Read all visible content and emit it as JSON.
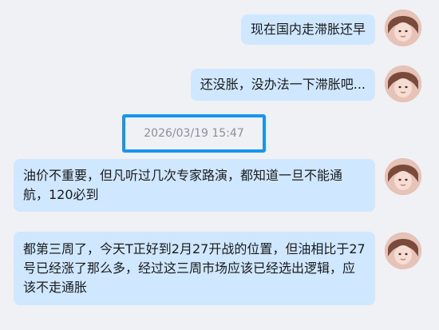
{
  "messages": [
    {
      "text": "现在国内走滞胀还早"
    },
    {
      "text": "还没胀，没办法一下滞胀吧..."
    },
    {
      "text": "油价不重要，但凡听过几次专家路演，都知道一旦不能通航，120必到"
    },
    {
      "text": "都第三周了，今天T正好到2月27开战的位置，但油相比于27号已经涨了那么多，经过这三周市场应该已经选出逻辑，应该不走通胀"
    }
  ],
  "timestamp": "2026/03/19 15:47",
  "colors": {
    "bubble": "#cfe8ff",
    "background": "#f0f1f5",
    "highlight_border": "#1596f0",
    "timestamp_text": "#8a8f98"
  },
  "icons": {
    "avatar": "user-avatar-icon"
  }
}
